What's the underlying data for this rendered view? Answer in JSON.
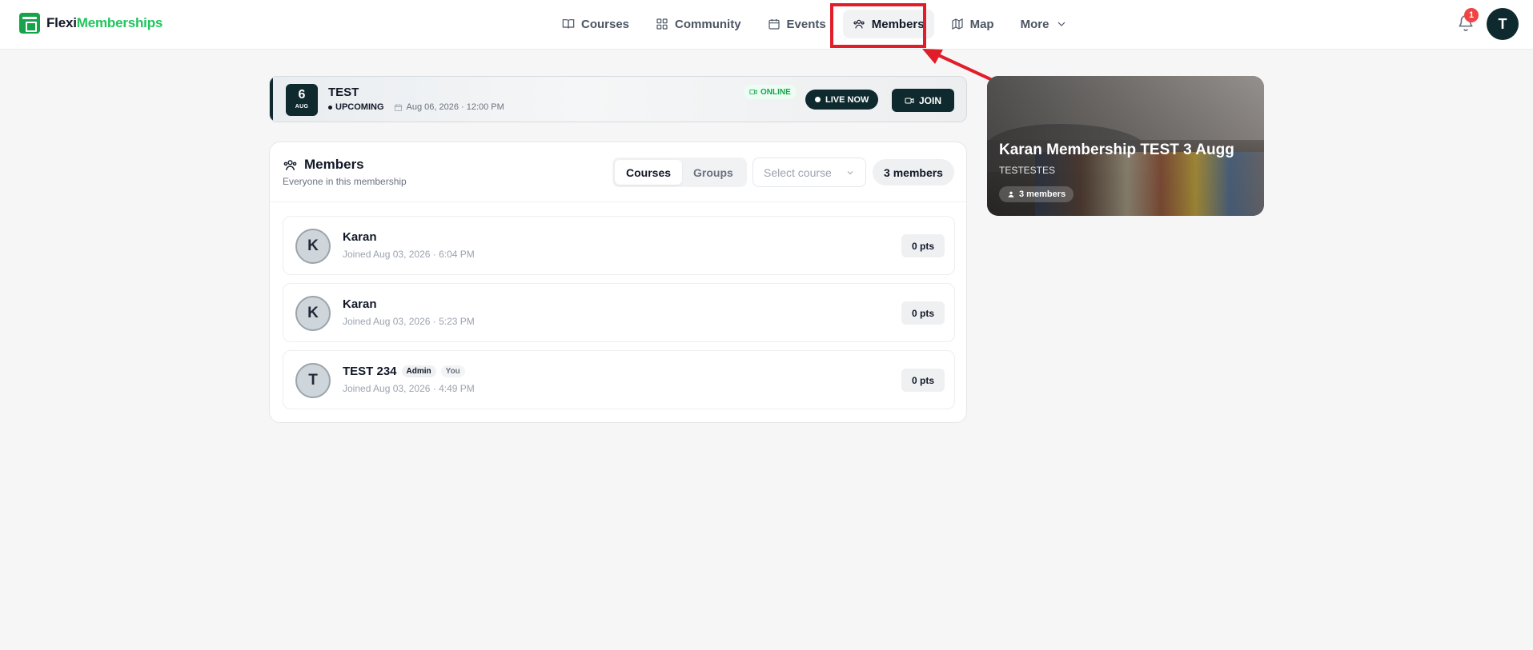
{
  "brand": {
    "name_part1": "Flexi",
    "name_part2": "Memberships",
    "color": "#22c55e"
  },
  "nav": {
    "items": [
      {
        "label": "Courses",
        "icon": "book-icon"
      },
      {
        "label": "Community",
        "icon": "grid-icon"
      },
      {
        "label": "Events",
        "icon": "calendar-icon"
      },
      {
        "label": "Members",
        "icon": "users-icon",
        "active": true
      },
      {
        "label": "Map",
        "icon": "map-icon"
      },
      {
        "label": "More",
        "icon": "chevron-down-icon"
      }
    ],
    "notifications_count": "1",
    "user_initial": "T"
  },
  "event": {
    "day": "6",
    "month": "AUG",
    "title": "TEST",
    "status": "UPCOMING",
    "datetime": "Aug 06, 2026 · 12:00 PM",
    "mode": "ONLINE",
    "live_label": "LIVE NOW",
    "join_label": "JOIN"
  },
  "members": {
    "title": "Members",
    "subtitle": "Everyone in this membership",
    "tabs": [
      "Courses",
      "Groups"
    ],
    "active_tab": "Courses",
    "select_placeholder": "Select course",
    "count_label": "3 members",
    "rows": [
      {
        "initial": "K",
        "name": "Karan",
        "joined": "Joined Aug 03, 2026 · 6:04 PM",
        "points": "0 pts",
        "tags": []
      },
      {
        "initial": "K",
        "name": "Karan",
        "joined": "Joined Aug 03, 2026 · 5:23 PM",
        "points": "0 pts",
        "tags": []
      },
      {
        "initial": "T",
        "name": "TEST 234",
        "joined": "Joined Aug 03, 2026 · 4:49 PM",
        "points": "0 pts",
        "tags": [
          "Admin",
          "You"
        ]
      }
    ]
  },
  "membership_card": {
    "title": "Karan Membership TEST 3 Augg",
    "subtitle": "TESTESTES",
    "members_label": "3 members"
  },
  "colors": {
    "dark": "#0f2a2e",
    "highlight": "#e11d2a",
    "online": "#16a34a"
  }
}
